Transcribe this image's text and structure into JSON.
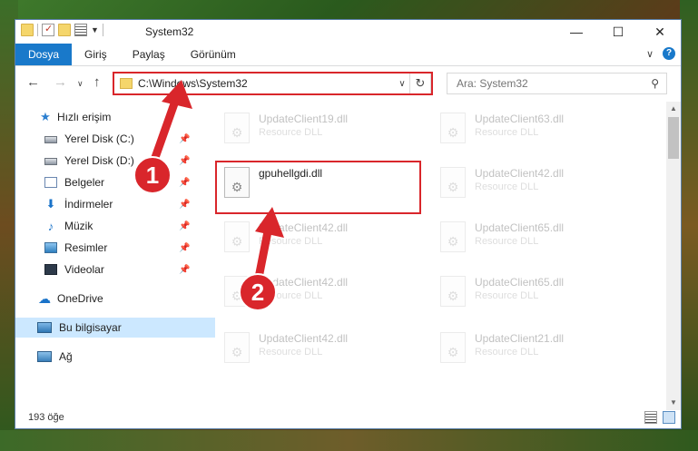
{
  "window": {
    "title": "System32",
    "controls": {
      "minimize": "—",
      "maximize": "☐",
      "close": "✕"
    }
  },
  "ribbon": {
    "tabs": [
      {
        "label": "Dosya",
        "active": true
      },
      {
        "label": "Giriş",
        "active": false
      },
      {
        "label": "Paylaş",
        "active": false
      },
      {
        "label": "Görünüm",
        "active": false
      }
    ],
    "help": "?"
  },
  "address": {
    "path": "C:\\Windows\\System32",
    "search_placeholder": "Ara: System32"
  },
  "sidebar": {
    "items": [
      {
        "label": "Hızlı erişim",
        "icon": "star-icon"
      },
      {
        "label": "Yerel Disk (C:)",
        "icon": "disk-icon",
        "pinned": true
      },
      {
        "label": "Yerel Disk (D:)",
        "icon": "disk-icon",
        "pinned": true
      },
      {
        "label": "Belgeler",
        "icon": "documents-icon",
        "pinned": true
      },
      {
        "label": "İndirmeler",
        "icon": "download-icon",
        "pinned": true
      },
      {
        "label": "Müzik",
        "icon": "music-icon",
        "pinned": true
      },
      {
        "label": "Resimler",
        "icon": "pictures-icon",
        "pinned": true
      },
      {
        "label": "Videolar",
        "icon": "videos-icon",
        "pinned": true
      },
      {
        "label": "OneDrive",
        "icon": "cloud-icon"
      },
      {
        "label": "Bu bilgisayar",
        "icon": "computer-icon",
        "selected": true
      },
      {
        "label": "Ağ",
        "icon": "network-icon"
      }
    ]
  },
  "files": [
    {
      "name": "UpdateClient19.dll",
      "type": "Resource DLL",
      "faded": true
    },
    {
      "name": "UpdateClient63.dll",
      "type": "Resource DLL",
      "faded": true
    },
    {
      "name": "gpuhellgdi.dll",
      "type": "",
      "faded": false
    },
    {
      "name": "UpdateClient42.dll",
      "type": "Resource DLL",
      "faded": true
    },
    {
      "name": "UpdateClient42.dll",
      "type": "Resource DLL",
      "faded": true
    },
    {
      "name": "UpdateClient65.dll",
      "type": "Resource DLL",
      "faded": true
    },
    {
      "name": "UpdateClient42.dll",
      "type": "Resource DLL",
      "faded": true
    },
    {
      "name": "UpdateClient65.dll",
      "type": "Resource DLL",
      "faded": true
    },
    {
      "name": "UpdateClient42.dll",
      "type": "Resource DLL",
      "faded": true
    },
    {
      "name": "UpdateClient21.dll",
      "type": "Resource DLL",
      "faded": true
    }
  ],
  "status": {
    "count": "193 öğe"
  },
  "annotations": {
    "step1": "1",
    "step2": "2",
    "color": "#d9262b"
  }
}
